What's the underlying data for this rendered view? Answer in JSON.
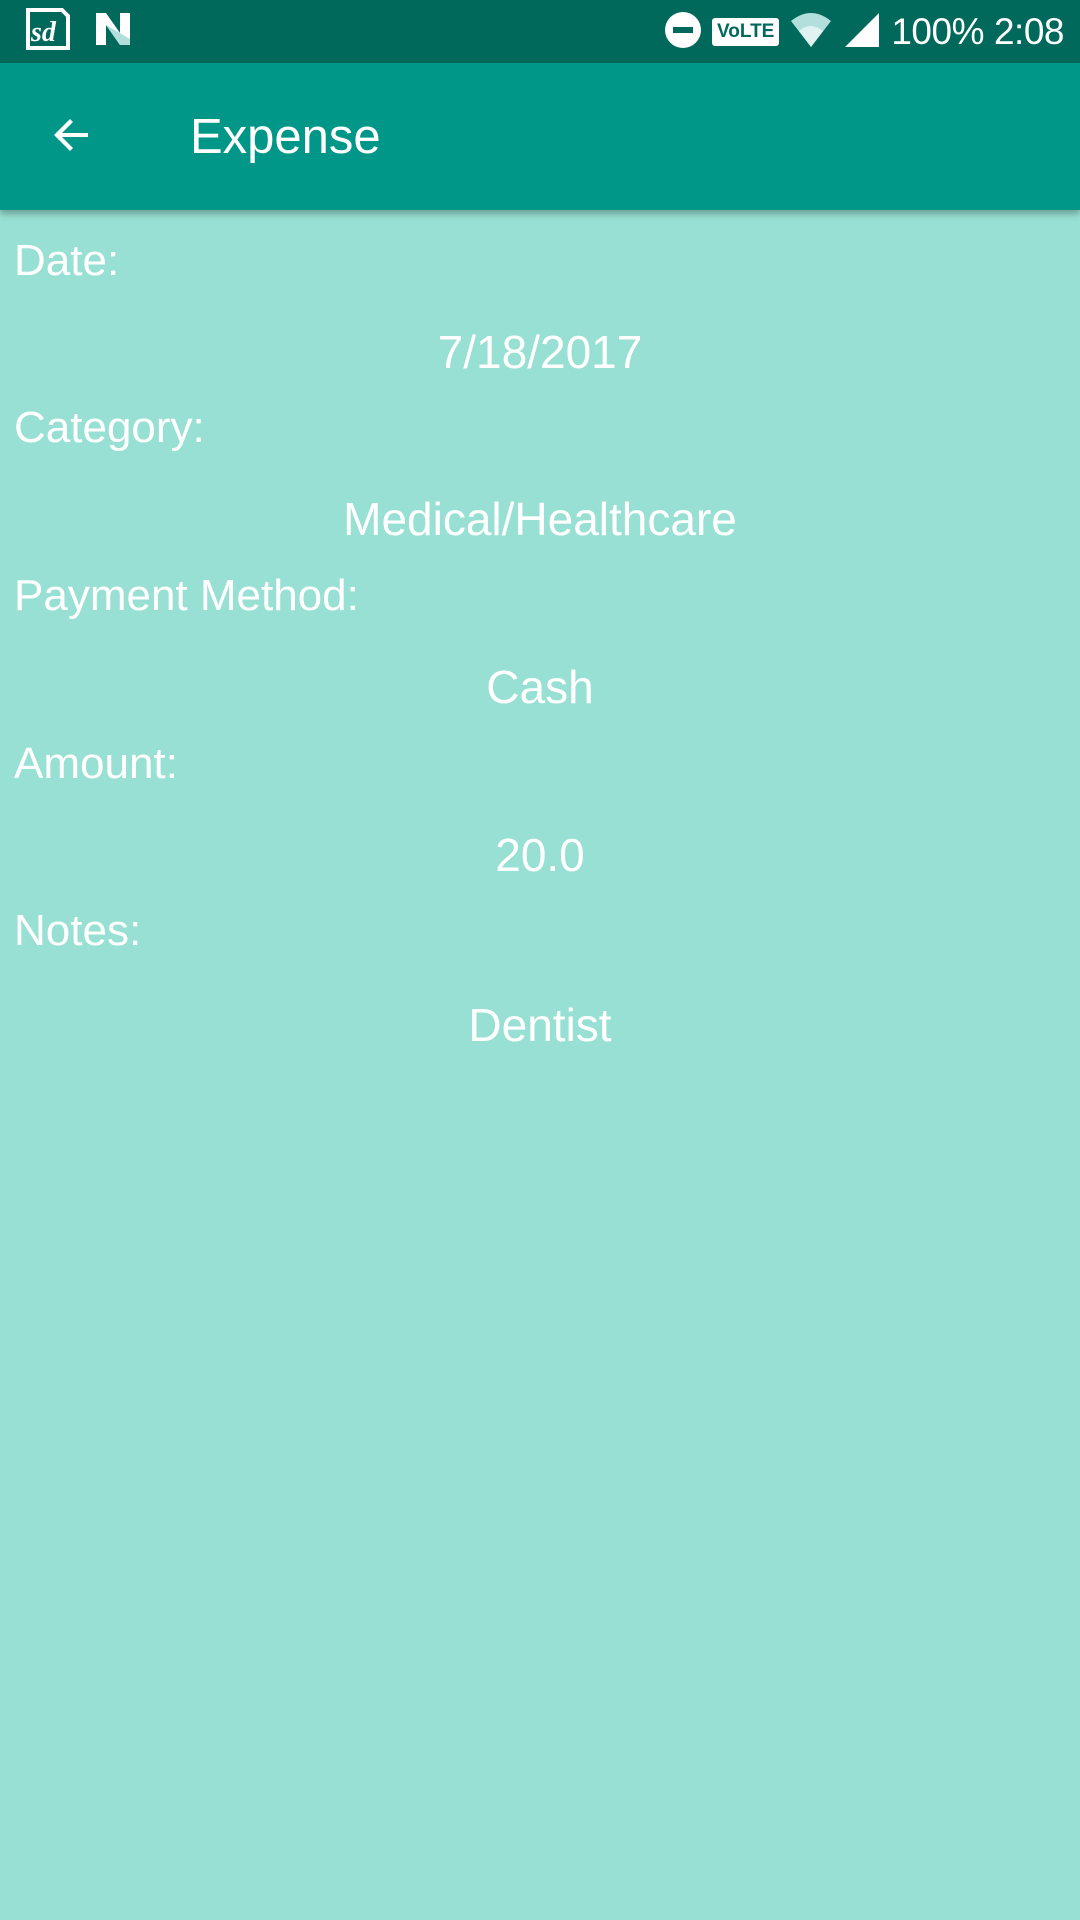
{
  "status_bar": {
    "battery": "100%",
    "time": "2:08",
    "volte": "VoLTE",
    "icons": [
      "sd-card-icon",
      "n-logo-icon",
      "do-not-disturb-icon",
      "volte-icon",
      "wifi-icon",
      "cell-signal-icon"
    ]
  },
  "app_bar": {
    "title": "Expense",
    "back_icon": "arrow-back-icon"
  },
  "fields": {
    "date_label": "Date:",
    "date_value": "7/18/2017",
    "category_label": "Category:",
    "category_value": "Medical/Healthcare",
    "payment_label": "Payment Method:",
    "payment_value": "Cash",
    "amount_label": "Amount:",
    "amount_value": "20.0",
    "notes_label": "Notes:",
    "notes_value": "Dentist"
  },
  "colors": {
    "status_bar": "#00695c",
    "app_bar": "#009688",
    "background": "#98e0d3",
    "text": "#ffffff"
  }
}
